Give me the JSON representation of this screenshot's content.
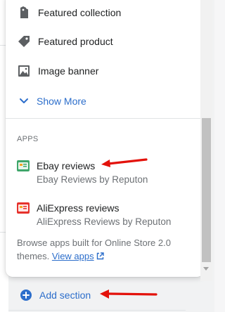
{
  "menu": {
    "items": [
      {
        "label": "Featured collection",
        "icon": "collection-tag-icon"
      },
      {
        "label": "Featured product",
        "icon": "product-tag-icon"
      },
      {
        "label": "Image banner",
        "icon": "image-icon"
      }
    ],
    "show_more_label": "Show More"
  },
  "apps": {
    "heading": "APPS",
    "items": [
      {
        "title": "Ebay reviews",
        "subtitle": "Ebay Reviews by Reputon",
        "icon": "ebay-app-icon"
      },
      {
        "title": "AliExpress reviews",
        "subtitle": "AliExpress Reviews by Reputon",
        "icon": "aliexpress-app-icon"
      }
    ],
    "browse_text": "Browse apps built for Online Store 2.0 themes.",
    "view_apps_label": "View apps"
  },
  "add_section_label": "Add section",
  "colors": {
    "link": "#2c6ecb",
    "annotation_arrow": "#e3120b"
  }
}
